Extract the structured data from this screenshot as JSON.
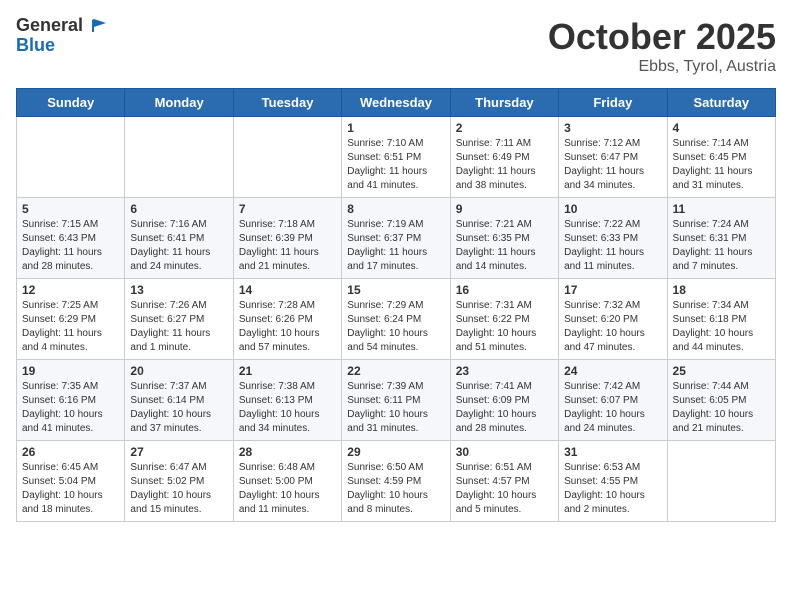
{
  "header": {
    "logo_line1": "General",
    "logo_line2": "Blue",
    "month": "October 2025",
    "location": "Ebbs, Tyrol, Austria"
  },
  "weekdays": [
    "Sunday",
    "Monday",
    "Tuesday",
    "Wednesday",
    "Thursday",
    "Friday",
    "Saturday"
  ],
  "weeks": [
    [
      {
        "day": "",
        "content": ""
      },
      {
        "day": "",
        "content": ""
      },
      {
        "day": "",
        "content": ""
      },
      {
        "day": "1",
        "content": "Sunrise: 7:10 AM\nSunset: 6:51 PM\nDaylight: 11 hours and 41 minutes."
      },
      {
        "day": "2",
        "content": "Sunrise: 7:11 AM\nSunset: 6:49 PM\nDaylight: 11 hours and 38 minutes."
      },
      {
        "day": "3",
        "content": "Sunrise: 7:12 AM\nSunset: 6:47 PM\nDaylight: 11 hours and 34 minutes."
      },
      {
        "day": "4",
        "content": "Sunrise: 7:14 AM\nSunset: 6:45 PM\nDaylight: 11 hours and 31 minutes."
      }
    ],
    [
      {
        "day": "5",
        "content": "Sunrise: 7:15 AM\nSunset: 6:43 PM\nDaylight: 11 hours and 28 minutes."
      },
      {
        "day": "6",
        "content": "Sunrise: 7:16 AM\nSunset: 6:41 PM\nDaylight: 11 hours and 24 minutes."
      },
      {
        "day": "7",
        "content": "Sunrise: 7:18 AM\nSunset: 6:39 PM\nDaylight: 11 hours and 21 minutes."
      },
      {
        "day": "8",
        "content": "Sunrise: 7:19 AM\nSunset: 6:37 PM\nDaylight: 11 hours and 17 minutes."
      },
      {
        "day": "9",
        "content": "Sunrise: 7:21 AM\nSunset: 6:35 PM\nDaylight: 11 hours and 14 minutes."
      },
      {
        "day": "10",
        "content": "Sunrise: 7:22 AM\nSunset: 6:33 PM\nDaylight: 11 hours and 11 minutes."
      },
      {
        "day": "11",
        "content": "Sunrise: 7:24 AM\nSunset: 6:31 PM\nDaylight: 11 hours and 7 minutes."
      }
    ],
    [
      {
        "day": "12",
        "content": "Sunrise: 7:25 AM\nSunset: 6:29 PM\nDaylight: 11 hours and 4 minutes."
      },
      {
        "day": "13",
        "content": "Sunrise: 7:26 AM\nSunset: 6:27 PM\nDaylight: 11 hours and 1 minute."
      },
      {
        "day": "14",
        "content": "Sunrise: 7:28 AM\nSunset: 6:26 PM\nDaylight: 10 hours and 57 minutes."
      },
      {
        "day": "15",
        "content": "Sunrise: 7:29 AM\nSunset: 6:24 PM\nDaylight: 10 hours and 54 minutes."
      },
      {
        "day": "16",
        "content": "Sunrise: 7:31 AM\nSunset: 6:22 PM\nDaylight: 10 hours and 51 minutes."
      },
      {
        "day": "17",
        "content": "Sunrise: 7:32 AM\nSunset: 6:20 PM\nDaylight: 10 hours and 47 minutes."
      },
      {
        "day": "18",
        "content": "Sunrise: 7:34 AM\nSunset: 6:18 PM\nDaylight: 10 hours and 44 minutes."
      }
    ],
    [
      {
        "day": "19",
        "content": "Sunrise: 7:35 AM\nSunset: 6:16 PM\nDaylight: 10 hours and 41 minutes."
      },
      {
        "day": "20",
        "content": "Sunrise: 7:37 AM\nSunset: 6:14 PM\nDaylight: 10 hours and 37 minutes."
      },
      {
        "day": "21",
        "content": "Sunrise: 7:38 AM\nSunset: 6:13 PM\nDaylight: 10 hours and 34 minutes."
      },
      {
        "day": "22",
        "content": "Sunrise: 7:39 AM\nSunset: 6:11 PM\nDaylight: 10 hours and 31 minutes."
      },
      {
        "day": "23",
        "content": "Sunrise: 7:41 AM\nSunset: 6:09 PM\nDaylight: 10 hours and 28 minutes."
      },
      {
        "day": "24",
        "content": "Sunrise: 7:42 AM\nSunset: 6:07 PM\nDaylight: 10 hours and 24 minutes."
      },
      {
        "day": "25",
        "content": "Sunrise: 7:44 AM\nSunset: 6:05 PM\nDaylight: 10 hours and 21 minutes."
      }
    ],
    [
      {
        "day": "26",
        "content": "Sunrise: 6:45 AM\nSunset: 5:04 PM\nDaylight: 10 hours and 18 minutes."
      },
      {
        "day": "27",
        "content": "Sunrise: 6:47 AM\nSunset: 5:02 PM\nDaylight: 10 hours and 15 minutes."
      },
      {
        "day": "28",
        "content": "Sunrise: 6:48 AM\nSunset: 5:00 PM\nDaylight: 10 hours and 11 minutes."
      },
      {
        "day": "29",
        "content": "Sunrise: 6:50 AM\nSunset: 4:59 PM\nDaylight: 10 hours and 8 minutes."
      },
      {
        "day": "30",
        "content": "Sunrise: 6:51 AM\nSunset: 4:57 PM\nDaylight: 10 hours and 5 minutes."
      },
      {
        "day": "31",
        "content": "Sunrise: 6:53 AM\nSunset: 4:55 PM\nDaylight: 10 hours and 2 minutes."
      },
      {
        "day": "",
        "content": ""
      }
    ]
  ]
}
